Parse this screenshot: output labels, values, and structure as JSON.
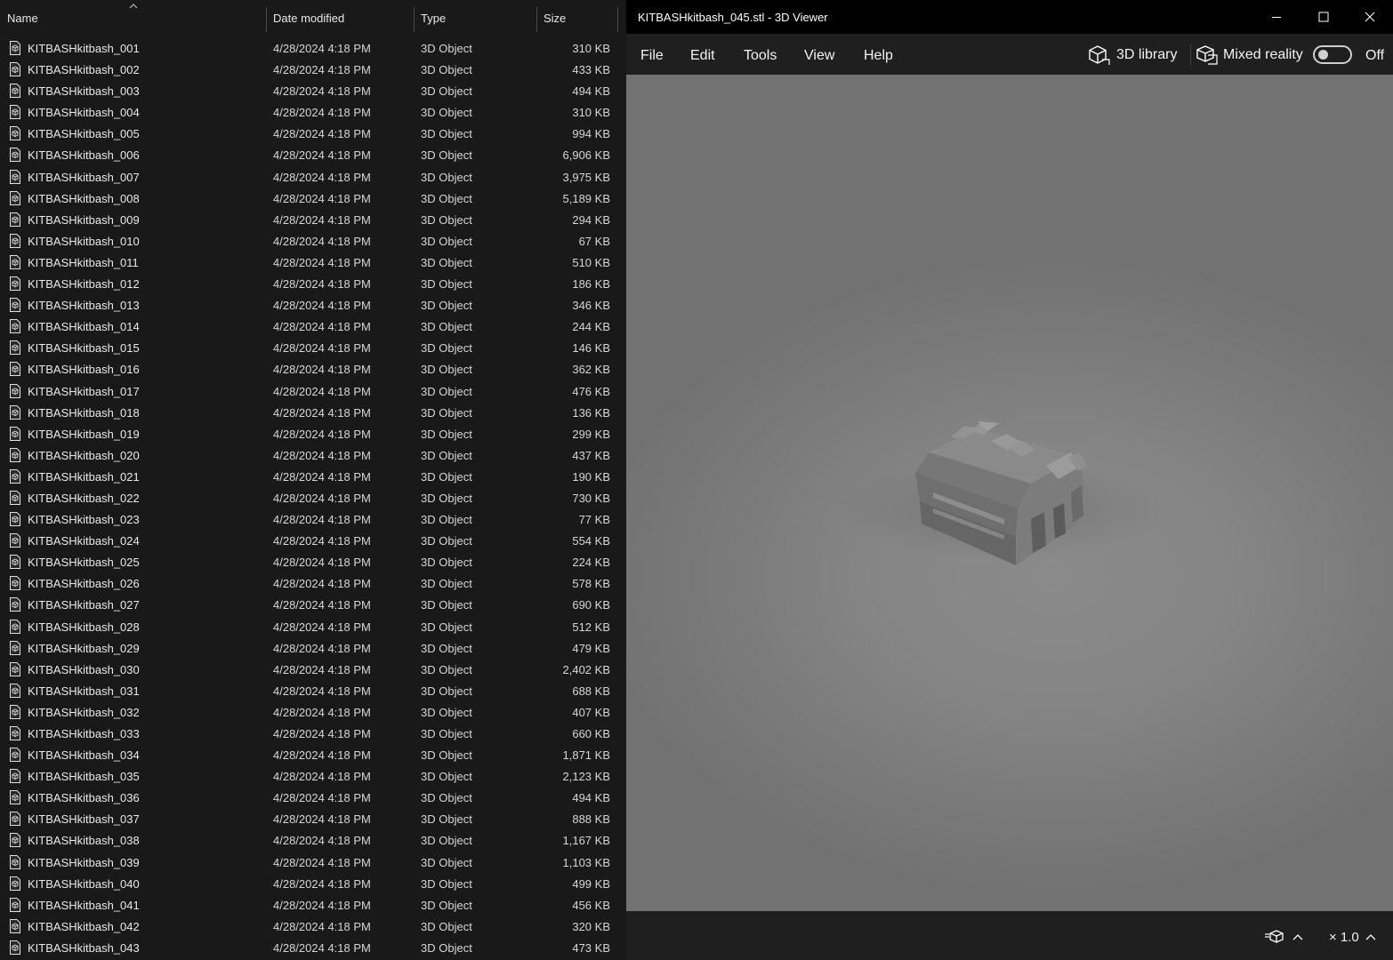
{
  "explorer": {
    "columns": {
      "name": "Name",
      "date": "Date modified",
      "type": "Type",
      "size": "Size"
    },
    "files": [
      {
        "name": "KITBASHkitbash_001",
        "date": "4/28/2024 4:18 PM",
        "type": "3D Object",
        "size": "310 KB"
      },
      {
        "name": "KITBASHkitbash_002",
        "date": "4/28/2024 4:18 PM",
        "type": "3D Object",
        "size": "433 KB"
      },
      {
        "name": "KITBASHkitbash_003",
        "date": "4/28/2024 4:18 PM",
        "type": "3D Object",
        "size": "494 KB"
      },
      {
        "name": "KITBASHkitbash_004",
        "date": "4/28/2024 4:18 PM",
        "type": "3D Object",
        "size": "310 KB"
      },
      {
        "name": "KITBASHkitbash_005",
        "date": "4/28/2024 4:18 PM",
        "type": "3D Object",
        "size": "994 KB"
      },
      {
        "name": "KITBASHkitbash_006",
        "date": "4/28/2024 4:18 PM",
        "type": "3D Object",
        "size": "6,906 KB"
      },
      {
        "name": "KITBASHkitbash_007",
        "date": "4/28/2024 4:18 PM",
        "type": "3D Object",
        "size": "3,975 KB"
      },
      {
        "name": "KITBASHkitbash_008",
        "date": "4/28/2024 4:18 PM",
        "type": "3D Object",
        "size": "5,189 KB"
      },
      {
        "name": "KITBASHkitbash_009",
        "date": "4/28/2024 4:18 PM",
        "type": "3D Object",
        "size": "294 KB"
      },
      {
        "name": "KITBASHkitbash_010",
        "date": "4/28/2024 4:18 PM",
        "type": "3D Object",
        "size": "67 KB"
      },
      {
        "name": "KITBASHkitbash_011",
        "date": "4/28/2024 4:18 PM",
        "type": "3D Object",
        "size": "510 KB"
      },
      {
        "name": "KITBASHkitbash_012",
        "date": "4/28/2024 4:18 PM",
        "type": "3D Object",
        "size": "186 KB"
      },
      {
        "name": "KITBASHkitbash_013",
        "date": "4/28/2024 4:18 PM",
        "type": "3D Object",
        "size": "346 KB"
      },
      {
        "name": "KITBASHkitbash_014",
        "date": "4/28/2024 4:18 PM",
        "type": "3D Object",
        "size": "244 KB"
      },
      {
        "name": "KITBASHkitbash_015",
        "date": "4/28/2024 4:18 PM",
        "type": "3D Object",
        "size": "146 KB"
      },
      {
        "name": "KITBASHkitbash_016",
        "date": "4/28/2024 4:18 PM",
        "type": "3D Object",
        "size": "362 KB"
      },
      {
        "name": "KITBASHkitbash_017",
        "date": "4/28/2024 4:18 PM",
        "type": "3D Object",
        "size": "476 KB"
      },
      {
        "name": "KITBASHkitbash_018",
        "date": "4/28/2024 4:18 PM",
        "type": "3D Object",
        "size": "136 KB"
      },
      {
        "name": "KITBASHkitbash_019",
        "date": "4/28/2024 4:18 PM",
        "type": "3D Object",
        "size": "299 KB"
      },
      {
        "name": "KITBASHkitbash_020",
        "date": "4/28/2024 4:18 PM",
        "type": "3D Object",
        "size": "437 KB"
      },
      {
        "name": "KITBASHkitbash_021",
        "date": "4/28/2024 4:18 PM",
        "type": "3D Object",
        "size": "190 KB"
      },
      {
        "name": "KITBASHkitbash_022",
        "date": "4/28/2024 4:18 PM",
        "type": "3D Object",
        "size": "730 KB"
      },
      {
        "name": "KITBASHkitbash_023",
        "date": "4/28/2024 4:18 PM",
        "type": "3D Object",
        "size": "77 KB"
      },
      {
        "name": "KITBASHkitbash_024",
        "date": "4/28/2024 4:18 PM",
        "type": "3D Object",
        "size": "554 KB"
      },
      {
        "name": "KITBASHkitbash_025",
        "date": "4/28/2024 4:18 PM",
        "type": "3D Object",
        "size": "224 KB"
      },
      {
        "name": "KITBASHkitbash_026",
        "date": "4/28/2024 4:18 PM",
        "type": "3D Object",
        "size": "578 KB"
      },
      {
        "name": "KITBASHkitbash_027",
        "date": "4/28/2024 4:18 PM",
        "type": "3D Object",
        "size": "690 KB"
      },
      {
        "name": "KITBASHkitbash_028",
        "date": "4/28/2024 4:18 PM",
        "type": "3D Object",
        "size": "512 KB"
      },
      {
        "name": "KITBASHkitbash_029",
        "date": "4/28/2024 4:18 PM",
        "type": "3D Object",
        "size": "479 KB"
      },
      {
        "name": "KITBASHkitbash_030",
        "date": "4/28/2024 4:18 PM",
        "type": "3D Object",
        "size": "2,402 KB"
      },
      {
        "name": "KITBASHkitbash_031",
        "date": "4/28/2024 4:18 PM",
        "type": "3D Object",
        "size": "688 KB"
      },
      {
        "name": "KITBASHkitbash_032",
        "date": "4/28/2024 4:18 PM",
        "type": "3D Object",
        "size": "407 KB"
      },
      {
        "name": "KITBASHkitbash_033",
        "date": "4/28/2024 4:18 PM",
        "type": "3D Object",
        "size": "660 KB"
      },
      {
        "name": "KITBASHkitbash_034",
        "date": "4/28/2024 4:18 PM",
        "type": "3D Object",
        "size": "1,871 KB"
      },
      {
        "name": "KITBASHkitbash_035",
        "date": "4/28/2024 4:18 PM",
        "type": "3D Object",
        "size": "2,123 KB"
      },
      {
        "name": "KITBASHkitbash_036",
        "date": "4/28/2024 4:18 PM",
        "type": "3D Object",
        "size": "494 KB"
      },
      {
        "name": "KITBASHkitbash_037",
        "date": "4/28/2024 4:18 PM",
        "type": "3D Object",
        "size": "888 KB"
      },
      {
        "name": "KITBASHkitbash_038",
        "date": "4/28/2024 4:18 PM",
        "type": "3D Object",
        "size": "1,167 KB"
      },
      {
        "name": "KITBASHkitbash_039",
        "date": "4/28/2024 4:18 PM",
        "type": "3D Object",
        "size": "1,103 KB"
      },
      {
        "name": "KITBASHkitbash_040",
        "date": "4/28/2024 4:18 PM",
        "type": "3D Object",
        "size": "499 KB"
      },
      {
        "name": "KITBASHkitbash_041",
        "date": "4/28/2024 4:18 PM",
        "type": "3D Object",
        "size": "456 KB"
      },
      {
        "name": "KITBASHkitbash_042",
        "date": "4/28/2024 4:18 PM",
        "type": "3D Object",
        "size": "320 KB"
      },
      {
        "name": "KITBASHkitbash_043",
        "date": "4/28/2024 4:18 PM",
        "type": "3D Object",
        "size": "473 KB"
      }
    ],
    "file_icon": "3d-object-file-icon"
  },
  "viewer": {
    "title": "KITBASHkitbash_045.stl - 3D Viewer",
    "window_buttons": [
      "minimize-icon",
      "maximize-icon",
      "close-icon"
    ],
    "menu": [
      "File",
      "Edit",
      "Tools",
      "View",
      "Help"
    ],
    "library_label": "3D library",
    "mixed_reality_label": "Mixed reality",
    "mixed_reality_state": "Off",
    "zoom_label": "× 1.0",
    "colors": {
      "viewport": "#858585",
      "chrome": "#1f1f1f",
      "titlebar": "#000000"
    }
  }
}
